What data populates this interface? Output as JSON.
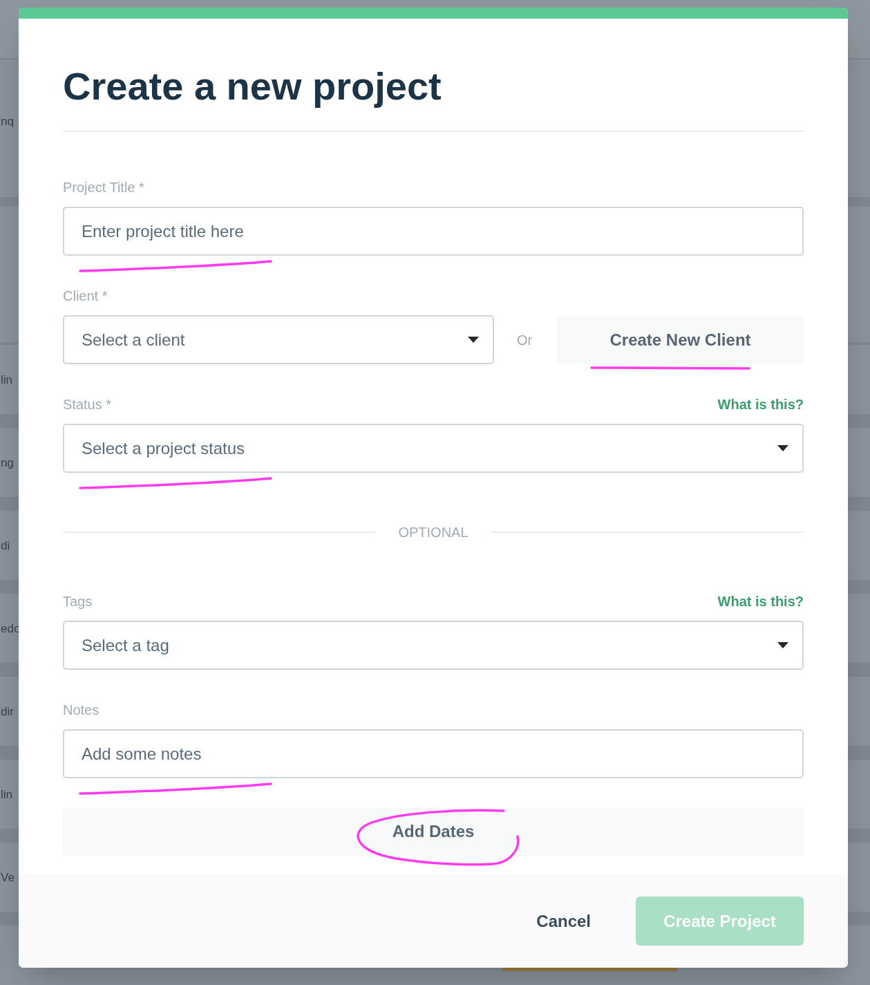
{
  "background_page": {
    "row_fragments": [
      "nq",
      "lin",
      "ng",
      "di",
      "edo",
      "dir",
      "lin",
      "Ve"
    ]
  },
  "dialog": {
    "title": "Create a new project",
    "fields": [
      {
        "kind": "input",
        "label": "Project Title *",
        "placeholder": "Enter project title here",
        "underlined": true
      },
      {
        "kind": "select_or_button",
        "label": "Client *",
        "placeholder": "Select a client",
        "separator": "Or",
        "button": {
          "label": "Create New Client",
          "underlined": true
        }
      },
      {
        "kind": "select",
        "label": "Status *",
        "help_link": "What is this?",
        "placeholder": "Select a project status",
        "underlined": true
      },
      {
        "kind": "divider",
        "label": "OPTIONAL"
      },
      {
        "kind": "select",
        "label": "Tags",
        "help_link": "What is this?",
        "placeholder": "Select a tag"
      },
      {
        "kind": "input",
        "label": "Notes",
        "placeholder": "Add some notes",
        "underlined": true
      },
      {
        "kind": "button",
        "label": "Add Dates",
        "circled": true
      }
    ],
    "footer": {
      "cancel": "Cancel",
      "submit": {
        "label": "Create Project",
        "disabled": true
      }
    }
  }
}
